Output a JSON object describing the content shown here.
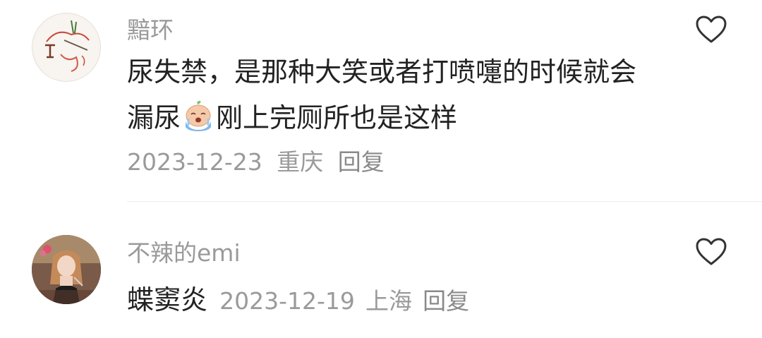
{
  "comments": [
    {
      "username": "黯环",
      "content_line1": "尿失禁，是那种大笑或者打喷嚏的时候就会",
      "content_line2_before": "漏尿",
      "content_line2_after": "刚上完厕所也是这样",
      "emoji_icon": "crying-face-emoji",
      "date": "2023-12-23",
      "location": "重庆",
      "reply_label": "回复"
    },
    {
      "username": "不辣的emi",
      "content": "蝶窦炎",
      "date": "2023-12-19",
      "location": "上海",
      "reply_label": "回复"
    }
  ],
  "colors": {
    "username": "#9a9a9a",
    "text": "#222222",
    "meta": "#9a9a9a",
    "divider": "#ececec",
    "heart_stroke": "#333333"
  }
}
